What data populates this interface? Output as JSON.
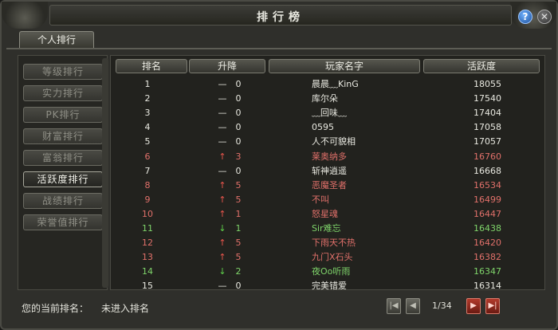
{
  "window": {
    "title": "排行榜"
  },
  "tabs": [
    {
      "label": "个人排行"
    }
  ],
  "sidebar": {
    "items": [
      {
        "label": "等级排行",
        "active": false
      },
      {
        "label": "实力排行",
        "active": false
      },
      {
        "label": "PK排行",
        "active": false
      },
      {
        "label": "财富排行",
        "active": false
      },
      {
        "label": "富翁排行",
        "active": false
      },
      {
        "label": "活跃度排行",
        "active": true
      },
      {
        "label": "战绩排行",
        "active": false
      },
      {
        "label": "荣誉值排行",
        "active": false
      }
    ]
  },
  "table": {
    "headers": {
      "rank": "排名",
      "change": "升降",
      "name": "玩家名字",
      "score": "活跃度"
    },
    "rows": [
      {
        "rank": "1",
        "arrow": "—",
        "delta": "0",
        "name": "晨晨﹏KinG",
        "score": "18055",
        "color": "#e8e8e0",
        "arrow_color": "#e8e8e0"
      },
      {
        "rank": "2",
        "arrow": "—",
        "delta": "0",
        "name": "库尔朵",
        "score": "17540",
        "color": "#e8e8e0",
        "arrow_color": "#e8e8e0"
      },
      {
        "rank": "3",
        "arrow": "—",
        "delta": "0",
        "name": "﹏回味﹏",
        "score": "17404",
        "color": "#e8e8e0",
        "arrow_color": "#e8e8e0"
      },
      {
        "rank": "4",
        "arrow": "—",
        "delta": "0",
        "name": "0595",
        "score": "17058",
        "color": "#e8e8e0",
        "arrow_color": "#e8e8e0"
      },
      {
        "rank": "5",
        "arrow": "—",
        "delta": "0",
        "name": "人不可貌相",
        "score": "17057",
        "color": "#e8e8e0",
        "arrow_color": "#e8e8e0"
      },
      {
        "rank": "6",
        "arrow": "↑",
        "delta": "3",
        "name": "莱奥纳多",
        "score": "16760",
        "color": "#e0706a",
        "arrow_color": "#e8554c"
      },
      {
        "rank": "7",
        "arrow": "—",
        "delta": "0",
        "name": "斩神逍遥",
        "score": "16668",
        "color": "#e8e8e0",
        "arrow_color": "#e8e8e0"
      },
      {
        "rank": "8",
        "arrow": "↑",
        "delta": "5",
        "name": "恶魔圣者",
        "score": "16534",
        "color": "#e0706a",
        "arrow_color": "#e8554c"
      },
      {
        "rank": "9",
        "arrow": "↑",
        "delta": "5",
        "name": "不叫",
        "score": "16499",
        "color": "#e0706a",
        "arrow_color": "#e8554c"
      },
      {
        "rank": "10",
        "arrow": "↑",
        "delta": "1",
        "name": "怒星魂",
        "score": "16447",
        "color": "#e0706a",
        "arrow_color": "#e8554c"
      },
      {
        "rank": "11",
        "arrow": "↓",
        "delta": "1",
        "name": "Sir难忘",
        "score": "16438",
        "color": "#7fd46a",
        "arrow_color": "#5fd04a"
      },
      {
        "rank": "12",
        "arrow": "↑",
        "delta": "5",
        "name": "下雨天不热",
        "score": "16420",
        "color": "#e0706a",
        "arrow_color": "#e8554c"
      },
      {
        "rank": "13",
        "arrow": "↑",
        "delta": "5",
        "name": "九门X石头",
        "score": "16382",
        "color": "#e0706a",
        "arrow_color": "#e8554c"
      },
      {
        "rank": "14",
        "arrow": "↓",
        "delta": "2",
        "name": "夜Oo听雨",
        "score": "16347",
        "color": "#7fd46a",
        "arrow_color": "#5fd04a"
      },
      {
        "rank": "15",
        "arrow": "—",
        "delta": "0",
        "name": "完美错爱",
        "score": "16314",
        "color": "#e8e8e0",
        "arrow_color": "#e8e8e0"
      }
    ]
  },
  "footer": {
    "current_rank_label": "您的当前排名：",
    "current_rank_value": "未进入排名",
    "page": "1/34"
  },
  "icons": {
    "help": "help-icon",
    "close": "close-icon",
    "first_page": "first-page-icon",
    "prev_page": "prev-page-icon",
    "next_page": "next-page-icon",
    "last_page": "last-page-icon"
  }
}
